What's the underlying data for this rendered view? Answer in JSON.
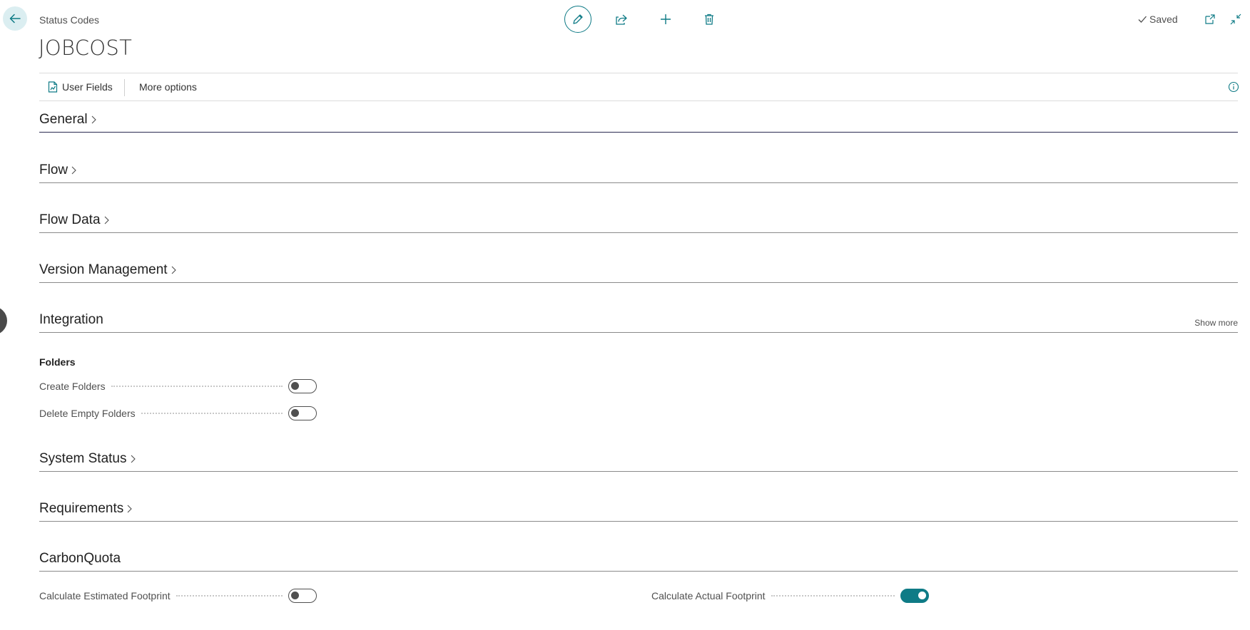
{
  "header": {
    "caption": "Status Codes",
    "record_title": "JOBCOST",
    "status": "Saved"
  },
  "toolbar": {
    "edit": "edit-icon",
    "share": "share-icon",
    "new": "plus-icon",
    "delete": "trash-icon"
  },
  "actions": {
    "user_fields": "User Fields",
    "more_options": "More options"
  },
  "sections": {
    "general": "General",
    "flow": "Flow",
    "flow_data": "Flow Data",
    "version_management": "Version Management",
    "integration": "Integration",
    "integration_show_more": "Show more",
    "system_status": "System Status",
    "requirements": "Requirements",
    "carbon_quota": "CarbonQuota"
  },
  "integration": {
    "group_title": "Folders",
    "fields": [
      {
        "label": "Create Folders",
        "value": false
      },
      {
        "label": "Delete Empty Folders",
        "value": false
      }
    ]
  },
  "carbon_quota": {
    "fields": [
      {
        "label": "Calculate Estimated Footprint",
        "value": false
      },
      {
        "label": "Calculate Actual Footprint",
        "value": true
      }
    ]
  },
  "colors": {
    "accent": "#0f7b86",
    "back_button_bg": "#dbeef1",
    "active_section_underline": "#2b2b52"
  }
}
